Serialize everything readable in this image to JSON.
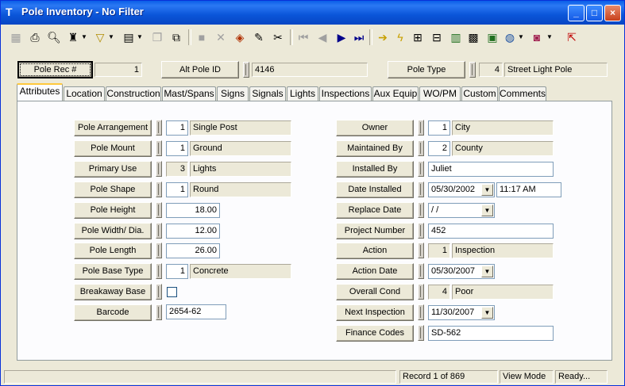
{
  "window": {
    "title": "Pole Inventory - No Filter",
    "app_icon": "T",
    "controls": {
      "minimize": "_",
      "maximize": "□",
      "close": "×"
    }
  },
  "toolbar": {
    "icons": [
      "save-icon",
      "print-icon",
      "print-preview-icon",
      "binoculars-icon",
      "filter-icon",
      "forms-icon",
      "copy-record-icon",
      "duplicate-icon",
      "new-record-icon",
      "delete-icon",
      "stamp-icon",
      "edit-icon",
      "cut-icon",
      "first-record-icon",
      "prev-record-icon",
      "next-record-icon",
      "last-record-icon",
      "arrow-right-icon",
      "lightning-icon",
      "tree-icon",
      "connect-icon",
      "chart-icon",
      "calculator-icon",
      "map-icon",
      "globe-icon",
      "book-icon",
      "exit-icon"
    ]
  },
  "header": {
    "pole_rec_label": "Pole Rec #",
    "pole_rec_value": "1",
    "alt_pole_label": "Alt Pole ID",
    "alt_pole_value": "4146",
    "pole_type_label": "Pole Type",
    "pole_type_code": "4",
    "pole_type_value": "Street Light Pole"
  },
  "tabs": [
    "Attributes",
    "Location",
    "Construction",
    "Mast/Spans",
    "Signs",
    "Signals",
    "Lights",
    "Inspections",
    "Aux Equip",
    "WO/PM",
    "Custom",
    "Comments"
  ],
  "left": {
    "pole_arrangement": {
      "label": "Pole Arrangement",
      "code": "1",
      "value": "Single Post"
    },
    "pole_mount": {
      "label": "Pole Mount",
      "code": "1",
      "value": "Ground"
    },
    "primary_use": {
      "label": "Primary Use",
      "code": "3",
      "value": "Lights"
    },
    "pole_shape": {
      "label": "Pole Shape",
      "code": "1",
      "value": "Round"
    },
    "pole_height": {
      "label": "Pole Height",
      "value": "18.00"
    },
    "pole_width": {
      "label": "Pole Width/ Dia.",
      "value": "12.00"
    },
    "pole_length": {
      "label": "Pole Length",
      "value": "26.00"
    },
    "pole_base_type": {
      "label": "Pole Base Type",
      "code": "1",
      "value": "Concrete"
    },
    "breakaway_base": {
      "label": "Breakaway Base"
    },
    "barcode": {
      "label": "Barcode",
      "value": "2654-62"
    }
  },
  "right": {
    "owner": {
      "label": "Owner",
      "code": "1",
      "value": "City"
    },
    "maintained_by": {
      "label": "Maintained By",
      "code": "2",
      "value": "County"
    },
    "installed_by": {
      "label": "Installed By",
      "value": "Juliet"
    },
    "date_installed": {
      "label": "Date Installed",
      "date": "05/30/2002",
      "time": "11:17 AM"
    },
    "replace_date": {
      "label": "Replace Date",
      "value": " /  /"
    },
    "project_number": {
      "label": "Project Number",
      "value": "452"
    },
    "action": {
      "label": "Action",
      "code": "1",
      "value": "Inspection"
    },
    "action_date": {
      "label": "Action Date",
      "value": "05/30/2007"
    },
    "overall_cond": {
      "label": "Overall Cond",
      "code": "4",
      "value": "Poor"
    },
    "next_inspection": {
      "label": "Next Inspection",
      "value": "11/30/2007"
    },
    "finance_codes": {
      "label": "Finance Codes",
      "value": "SD-562"
    }
  },
  "status": {
    "record": "Record 1 of 869",
    "mode": "View Mode",
    "state": "Ready..."
  }
}
